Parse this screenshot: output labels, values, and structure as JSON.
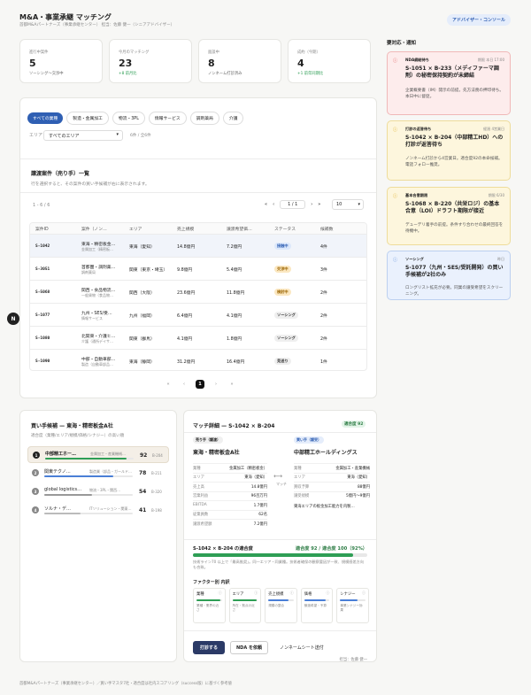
{
  "header": {
    "title": "M&A・事業承継 マッチング",
    "subtitle": "首都M&Aパートナーズ（事業承継センター） 担当：佐藤 健一（シニアアドバイザー）",
    "console": "アドバイザー・コンソール"
  },
  "kpis": [
    {
      "label": "進行中案件",
      "value": "5",
      "sub": "ソーシング〜交渉中",
      "accent": "#666"
    },
    {
      "label": "今月のマッチング",
      "value": "23",
      "sub": "+8 前月比",
      "accent": "#2e9e55"
    },
    {
      "label": "面談中",
      "value": "8",
      "sub": "ノンネーム打診済み",
      "accent": "#666"
    },
    {
      "label": "成約（今期）",
      "value": "4",
      "sub": "+1 前年同期比",
      "accent": "#2e9e55"
    }
  ],
  "filters": {
    "chips": [
      "すべての業種",
      "製造・金属加工",
      "物流・3PL",
      "情報サービス",
      "調剤薬局",
      "介護"
    ],
    "area_label": "エリア",
    "area_value": "すべてのエリア",
    "count": "6件 / 全6件"
  },
  "listing": {
    "title": "譲渡案件（売り手）一覧",
    "desc": "行を選択すると、その案件の買い手候補が右に表示されます。",
    "range": "1 - 6 / 6",
    "page": "1 / 1",
    "page_size": "10",
    "columns": [
      "案件ID",
      "案件（ノン…",
      "エリア",
      "売上規模",
      "譲渡希望価…",
      "ステータス",
      "候補数"
    ],
    "rows": [
      {
        "id": "S-1042",
        "name": "東海・精密板金…",
        "sub": "金属加工（精密板…",
        "area": "東海（愛知）",
        "sales": "14.8億円",
        "price": "7.2億円",
        "status": "接触中",
        "count": "4件"
      },
      {
        "id": "S-3051",
        "name": "首都圏・調剤薬…",
        "sub": "調剤薬局",
        "area": "関東（東京・埼玉）",
        "sales": "9.8億円",
        "price": "5.4億円",
        "status": "交渉中",
        "count": "3件"
      },
      {
        "id": "S-5068",
        "name": "関西・食品物流…",
        "sub": "一般貨物（食品物…",
        "area": "関西（大阪）",
        "sales": "23.6億円",
        "price": "11.8億円",
        "status": "検討中",
        "count": "2件"
      },
      {
        "id": "S-1077",
        "name": "九州・SES/受…",
        "sub": "情報サービス",
        "area": "九州（福岡）",
        "sales": "6.4億円",
        "price": "4.1億円",
        "status": "ソーシング",
        "count": "2件"
      },
      {
        "id": "S-1080",
        "name": "北関東・介護ヒ…",
        "sub": "介護（通所デイサ…",
        "area": "関東（群馬）",
        "sales": "4.1億円",
        "price": "1.8億円",
        "status": "ソーシング",
        "count": "2件"
      },
      {
        "id": "S-1090",
        "name": "中部・自動車部…",
        "sub": "製造（自動車部品…",
        "area": "東海（静岡）",
        "sales": "31.2億円",
        "price": "16.4億円",
        "status": "見送り",
        "count": "1件"
      }
    ],
    "status_colors": {
      "接触中": "#dce8fb",
      "交渉中": "#fbe7c0",
      "検討中": "#fbe7c0",
      "ソーシング": "#efefef",
      "見送り": "#efefef"
    },
    "status_text": {
      "接触中": "#2f5fb3",
      "交渉中": "#9a6400",
      "検討中": "#9a6400",
      "ソーシング": "#333",
      "見送り": "#333"
    },
    "pager": [
      "«",
      "‹",
      "1",
      "›",
      "»"
    ]
  },
  "buyers": {
    "title": "買い手候補 — 東海・精密板金A社",
    "desc": "適合度（業種/エリア/規模/価格/シナジー）の高い順",
    "items": [
      {
        "rank": "1",
        "name": "中部精工ホー…",
        "tag": "金属加工・産業機械…",
        "score": 92,
        "id": "B-204",
        "color": "#2e9e55"
      },
      {
        "rank": "2",
        "name": "関東テクノ…",
        "tag": "製造業（部品・ガールド…",
        "score": 78,
        "id": "B-211",
        "color": "#4a7fd6"
      },
      {
        "rank": "3",
        "name": "global logistics…",
        "tag": "物流・3PL・関西…",
        "score": 54,
        "id": "B-320",
        "color": "#999"
      },
      {
        "rank": "4",
        "name": "ソルナ・デ…",
        "tag": "ITソリューション・関東…",
        "score": 41,
        "id": "B-198",
        "color": "#bbb"
      }
    ]
  },
  "detail": {
    "title": "マッチ詳細 — S-1042 × B-204",
    "badge": "適合度 92",
    "seller": {
      "role": "売り手（譲渡）",
      "name": "東海・精密板金A社",
      "rows": [
        [
          "業種",
          "金属加工（精密板金）"
        ],
        [
          "エリア",
          "東海（愛知）"
        ],
        [
          "売上高",
          "14.8億円"
        ],
        [
          "営業利益",
          "96百万円"
        ],
        [
          "EBITDA",
          "1.7億円"
        ],
        [
          "従業員数",
          "62名"
        ],
        [
          "譲渡希望額",
          "7.2億円"
        ]
      ]
    },
    "buyer": {
      "role": "買い手（譲受）",
      "name": "中部精工ホールディングス",
      "rows": [
        [
          "業種",
          "金属加工・産業機械"
        ],
        [
          "エリア",
          "東海（愛知）"
        ],
        [
          "買収予算",
          "88億円"
        ],
        [
          "譲受規模",
          "5億円〜9億円"
        ]
      ],
      "note": "東海エリアの板金加工能力を内製…"
    },
    "arrow": "マッチ",
    "fit_label": "S-1042 × B-204 の適合度",
    "fit_value": "適合度 92 / 適合度 100（92%）",
    "fit_pct": 92,
    "fit_note": "技術ライン70 以上で「最高推奨」。同一エリア・同業種。技術者確保の観察要因が一致、規模感差方向も合致。",
    "factors_title": "ファクター別 内訳",
    "factors": [
      {
        "name": "業種",
        "sub": "業種・業界の近さ",
        "pct": 95,
        "color": "#2e9e55"
      },
      {
        "name": "エリア",
        "sub": "所在・拠点の近さ",
        "pct": 95,
        "color": "#2e9e55"
      },
      {
        "name": "売上規模",
        "sub": "規模の整合",
        "pct": 80,
        "color": "#4a7fd6"
      },
      {
        "name": "価格",
        "sub": "譲渡希望・予算",
        "pct": 85,
        "color": "#4a7fd6"
      },
      {
        "name": "シナジー",
        "sub": "事業シナジー効果",
        "pct": 70,
        "color": "#4a7fd6"
      }
    ],
    "actions": {
      "primary": "打診する",
      "nda": "NDA を依頼",
      "nonname": "ノンネームシート送付",
      "owner": "担当：佐藤 健一"
    }
  },
  "alerts": {
    "title": "要対応・通知",
    "items": [
      {
        "tag": "NDA締結待ち",
        "time": "期限 本日 17:00",
        "title": "S-1051 × B-233（メディファーマ調剤）の秘密保持契約が未締結",
        "body": "企業概要書（IM）開示の前提。先方法務の押印待ち。本日中に督促。",
        "bg": "#fdecec",
        "border": "#f0b8b8",
        "icon": "#d44"
      },
      {
        "tag": "打診の返答待ち",
        "time": "経過 4営業日",
        "title": "S-1042 × B-204（中部精工HD）への打診が返答待ち",
        "body": "ノンネーム打診から4営業日。適合度92の本命候補。電話フォロー推奨。",
        "bg": "#fdf6dd",
        "border": "#eedc9a",
        "icon": "#d9a200"
      },
      {
        "tag": "基本合意期限",
        "time": "期限 6/30",
        "title": "S-1068 × B-220（共栄ロジ）の基本合意（LOI）ドラフト期限が接近",
        "body": "デューデリ着手の前提。条件すり合わせの最終回答を待機中。",
        "bg": "#fdf6dd",
        "border": "#eedc9a",
        "icon": "#d9a200"
      },
      {
        "tag": "ソーシング",
        "time": "昨日",
        "title": "S-1077（九州・SES/受託開発）の買い手候補が2社のみ",
        "body": "ロングリスト拡充が必要。同業の譲受希望をスクリーニング。",
        "bg": "#eaf1fd",
        "border": "#bcd0f0",
        "icon": "#4a7fd6"
      }
    ]
  },
  "fab": "N",
  "footer": "首都M&Aパートナーズ（事業承継センター）／買い手マスタ7社・適合度は社内スコアリング（success版）に基づく参考値"
}
